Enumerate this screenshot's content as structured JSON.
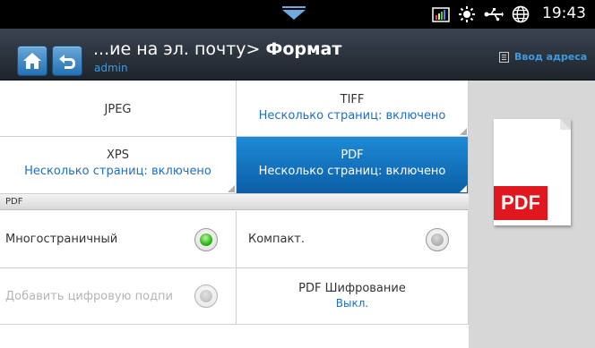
{
  "status_bar": {
    "time": "19:43",
    "icons": [
      "pulldown-arrow-icon",
      "signal-bars-icon",
      "sun-icon",
      "usb-icon",
      "globe-icon"
    ]
  },
  "header": {
    "title_prefix": "...ие на эл. почту> ",
    "title_current": "Формат",
    "user": "admin",
    "address_button": "Ввод адреса"
  },
  "formats": [
    {
      "name": "JPEG",
      "detail": ""
    },
    {
      "name": "TIFF",
      "detail": "Несколько страниц: включено"
    },
    {
      "name": "XPS",
      "detail": "Несколько страниц: включено"
    },
    {
      "name": "PDF",
      "detail": "Несколько страниц: включено",
      "selected": true
    }
  ],
  "section": {
    "label": "PDF"
  },
  "options": {
    "multipage": {
      "label": "Многостраничный",
      "on": true
    },
    "compact": {
      "label": "Компакт.",
      "on": false
    },
    "digital_signature": {
      "label": "Добавить цифровую подпи",
      "on": false,
      "disabled": true
    },
    "encryption": {
      "label": "PDF Шифрование",
      "value": "Выкл."
    }
  },
  "preview": {
    "badge": "PDF"
  },
  "colors": {
    "accent": "#3f9ae0",
    "selected_bg": "#0b5ea6",
    "radio_on": "#2fb51a",
    "pdf_red": "#e0171e"
  }
}
